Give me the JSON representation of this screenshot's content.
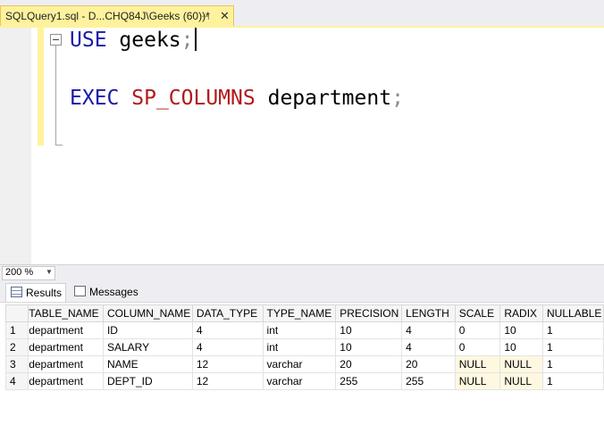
{
  "tab": {
    "title": "SQLQuery1.sql - D...CHQ84J\\Geeks (60))*",
    "pin": "⊣",
    "close": "✕"
  },
  "editor": {
    "line1": {
      "keyword": "USE",
      "ident": "geeks",
      "punc": ";"
    },
    "line2": {
      "keyword": "EXEC",
      "proc": "SP_COLUMNS",
      "ident": "department",
      "punc": ";"
    }
  },
  "zoom": {
    "value": "200 %"
  },
  "result_tabs": {
    "results": "Results",
    "messages": "Messages"
  },
  "grid": {
    "columns": [
      "TABLE_NAME",
      "COLUMN_NAME",
      "DATA_TYPE",
      "TYPE_NAME",
      "PRECISION",
      "LENGTH",
      "SCALE",
      "RADIX",
      "NULLABLE"
    ],
    "rows": [
      {
        "n": "1",
        "cells": [
          "department",
          "ID",
          "4",
          "int",
          "10",
          "4",
          "0",
          "10",
          "1"
        ]
      },
      {
        "n": "2",
        "cells": [
          "department",
          "SALARY",
          "4",
          "int",
          "10",
          "4",
          "0",
          "10",
          "1"
        ]
      },
      {
        "n": "3",
        "cells": [
          "department",
          "NAME",
          "12",
          "varchar",
          "20",
          "20",
          "NULL",
          "NULL",
          "1"
        ]
      },
      {
        "n": "4",
        "cells": [
          "department",
          "DEPT_ID",
          "12",
          "varchar",
          "255",
          "255",
          "NULL",
          "NULL",
          "1"
        ]
      }
    ]
  }
}
